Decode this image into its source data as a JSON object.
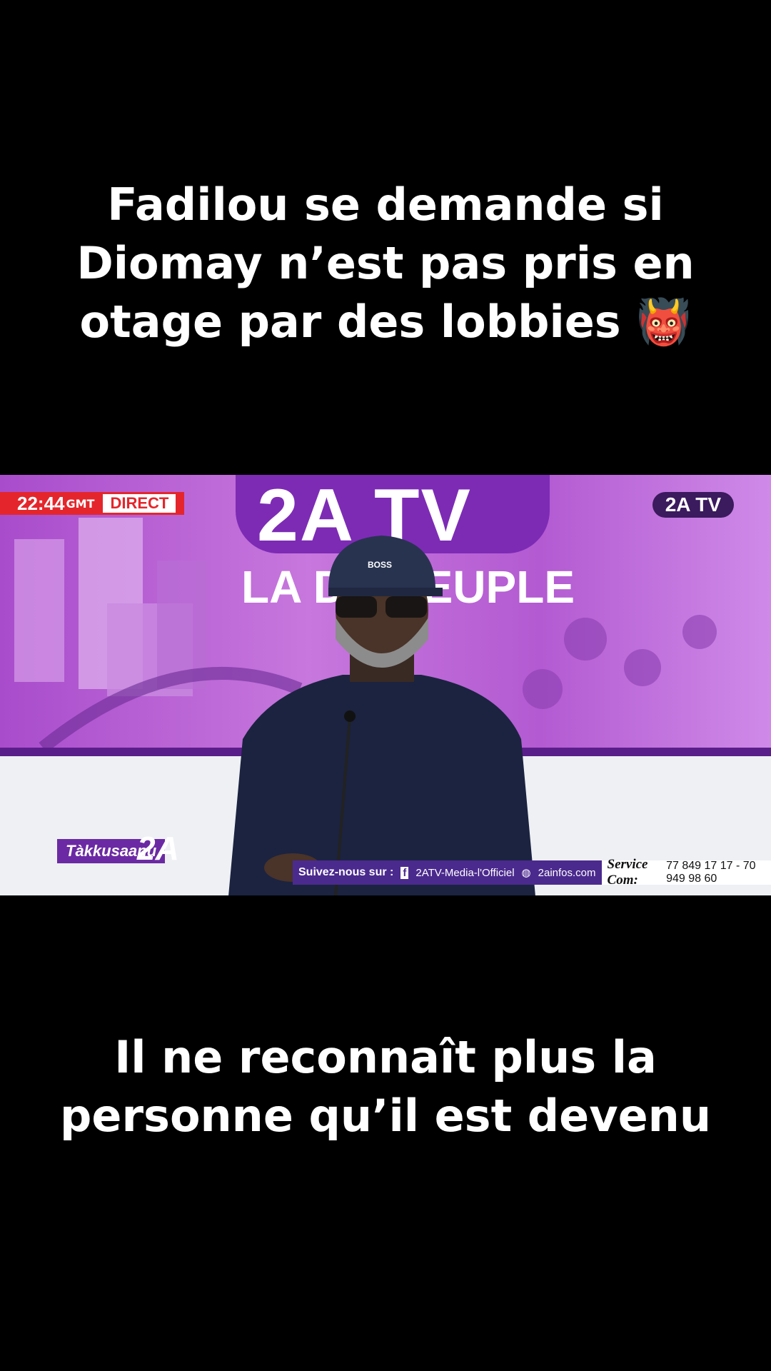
{
  "captions": {
    "top": [
      "Fadilou se demande si",
      "Diomay n’est pas pris en",
      "otage par des lobbies 👹"
    ],
    "bottom": [
      "Il ne reconnaît plus la",
      "personne qu’il est devenu"
    ]
  },
  "video": {
    "clock": "22:44",
    "tz": "GMT",
    "live_label": "DIRECT",
    "channel_logo": "2A TV",
    "corner_logo": "2A TV",
    "slogan": "LA DU PEUPLE",
    "cap_text": "BOSS",
    "show_name": "Tàkkusaanu",
    "show_badge": "2A",
    "follow_label": "Suivez-nous sur :",
    "facebook": "2ATV-Media-l'Officiel",
    "website": "2ainfos.com",
    "service_label": "Service Com:",
    "phones": "77 849 17 17 - 70 949 98 60",
    "colors": {
      "accent_red": "#e4262c",
      "brand_purple": "#7d2bb5"
    }
  }
}
